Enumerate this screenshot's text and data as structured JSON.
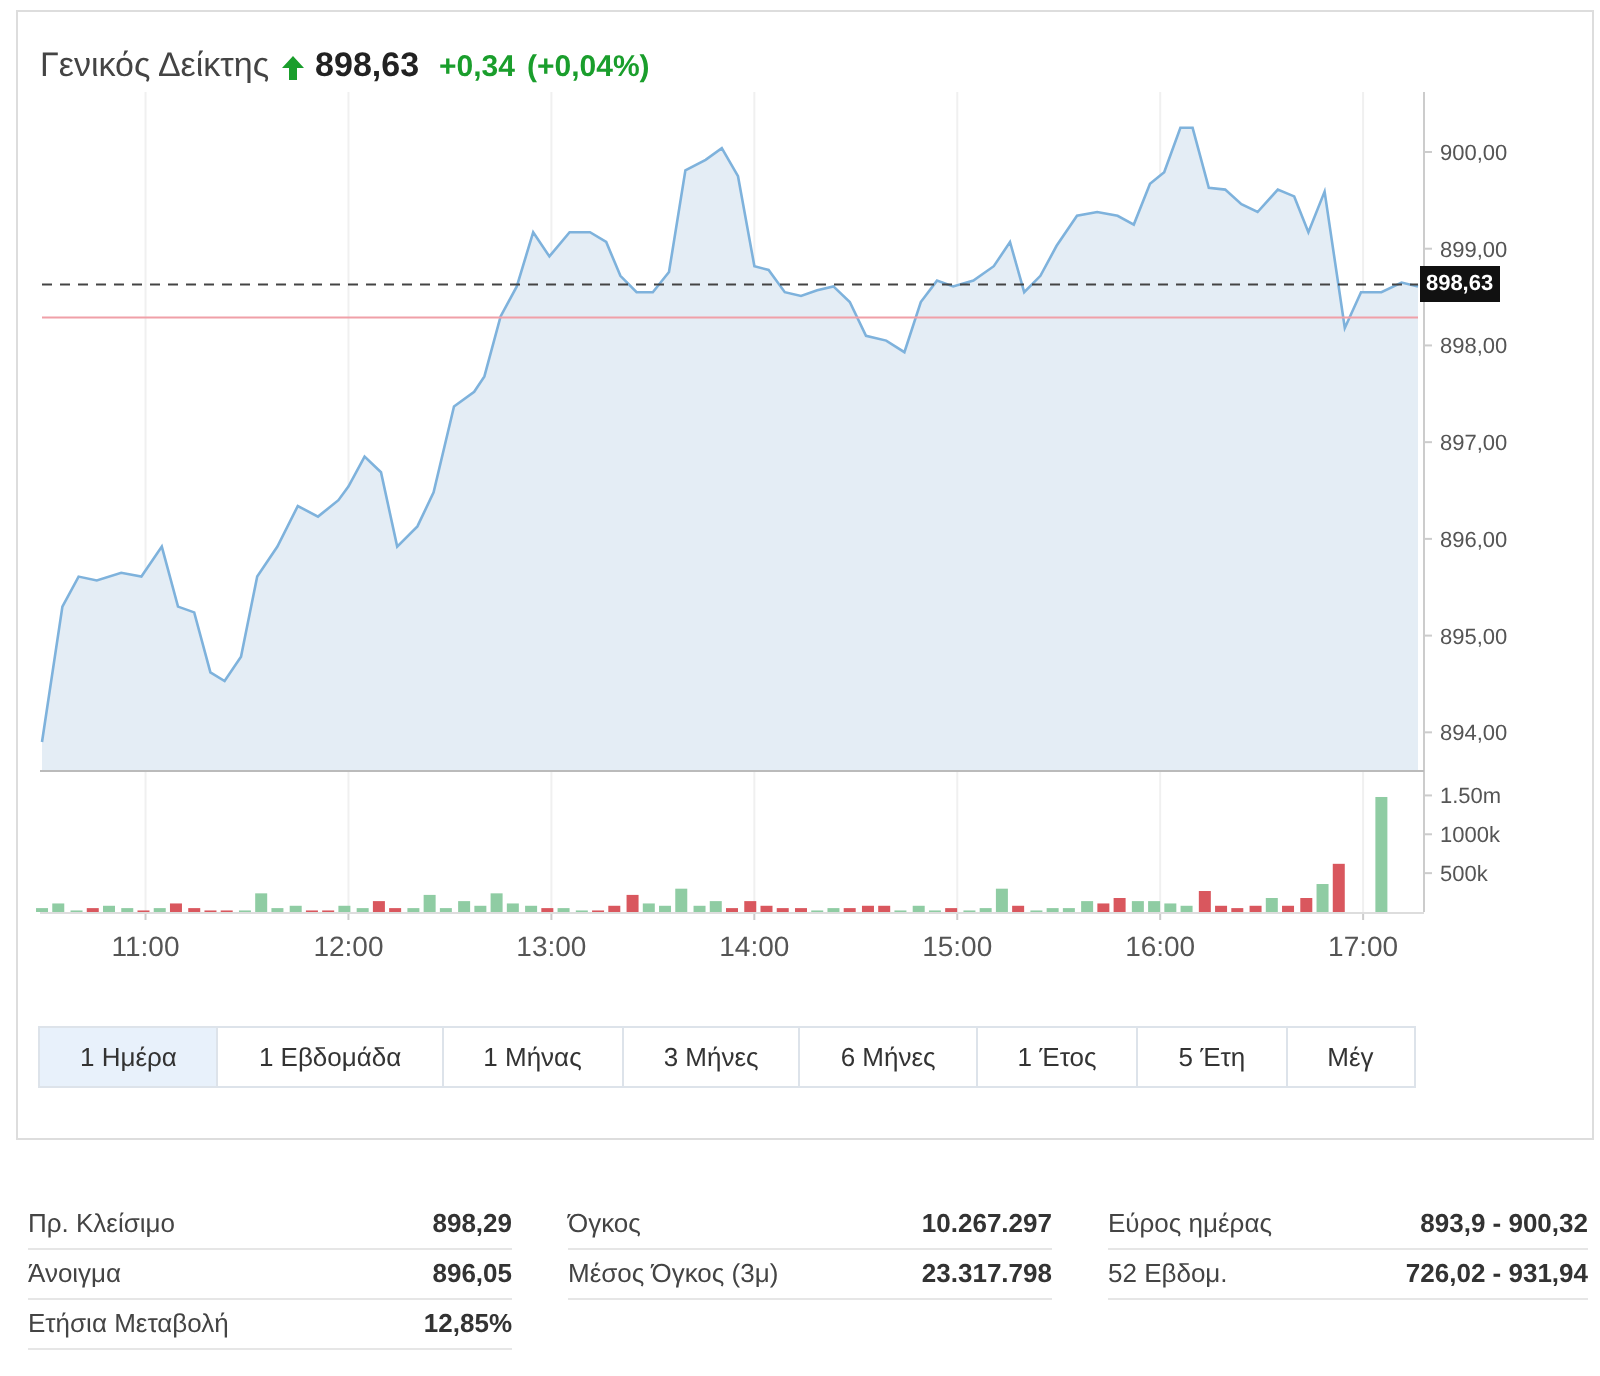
{
  "header": {
    "title": "Γενικός Δείκτης",
    "rising": true,
    "price": "898,63",
    "change": "+0,34",
    "change_percent": "(+0,04%)"
  },
  "price_chart": {
    "chart_data": {
      "type": "area",
      "grid": true,
      "xlim": [
        10.48,
        17.3
      ],
      "ylim": [
        893.59,
        900.62
      ],
      "yticks": [
        {
          "value": 894,
          "label": "894,00"
        },
        {
          "value": 895,
          "label": "895,00"
        },
        {
          "value": 896,
          "label": "896,00"
        },
        {
          "value": 897,
          "label": "897,00"
        },
        {
          "value": 898,
          "label": "898,00"
        },
        {
          "value": 899,
          "label": "899,00"
        },
        {
          "value": 900,
          "label": "900,00"
        }
      ],
      "x": [
        10.49,
        10.59,
        10.67,
        10.76,
        10.88,
        10.98,
        11.08,
        11.16,
        11.24,
        11.32,
        11.39,
        11.47,
        11.55,
        11.65,
        11.75,
        11.85,
        11.95,
        12.0,
        12.08,
        12.16,
        12.24,
        12.34,
        12.42,
        12.52,
        12.62,
        12.67,
        12.75,
        12.83,
        12.91,
        12.99,
        13.09,
        13.19,
        13.27,
        13.34,
        13.42,
        13.5,
        13.58,
        13.66,
        13.76,
        13.84,
        13.92,
        14.0,
        14.07,
        14.15,
        14.23,
        14.31,
        14.39,
        14.47,
        14.55,
        14.65,
        14.74,
        14.82,
        14.9,
        14.98,
        15.08,
        15.18,
        15.26,
        15.33,
        15.41,
        15.49,
        15.59,
        15.69,
        15.79,
        15.87,
        15.95,
        16.02,
        16.1,
        16.16,
        16.24,
        16.32,
        16.4,
        16.48,
        16.58,
        16.66,
        16.73,
        16.81,
        16.91,
        16.99,
        17.09,
        17.19,
        17.27
      ],
      "series": [
        {
          "color": "#7eb2dc",
          "values": [
            893.9,
            895.3,
            895.61,
            895.57,
            895.65,
            895.61,
            895.92,
            895.3,
            895.24,
            894.62,
            894.53,
            894.78,
            895.61,
            895.92,
            896.34,
            896.23,
            896.4,
            896.54,
            896.85,
            896.69,
            895.92,
            896.13,
            896.48,
            897.37,
            897.52,
            897.68,
            898.3,
            898.61,
            899.17,
            898.92,
            899.17,
            899.17,
            899.07,
            898.72,
            898.55,
            898.55,
            898.76,
            899.81,
            899.92,
            900.04,
            899.75,
            898.82,
            898.78,
            898.55,
            898.51,
            898.57,
            898.61,
            898.45,
            898.1,
            898.05,
            897.93,
            898.45,
            898.67,
            898.61,
            898.67,
            898.82,
            899.07,
            898.55,
            898.72,
            899.03,
            899.34,
            899.38,
            899.34,
            899.25,
            899.67,
            899.79,
            900.25,
            900.25,
            899.63,
            899.61,
            899.46,
            899.38,
            899.61,
            899.54,
            899.17,
            899.59,
            898.18,
            898.55,
            898.55,
            898.65,
            898.61
          ]
        },
        {
          "color": "#444444",
          "type": "line",
          "line_style": "dashed",
          "values": [
            898.63,
            null,
            null,
            null,
            null,
            null,
            null,
            null,
            null,
            null,
            null,
            null,
            null,
            null,
            null,
            null,
            null,
            null,
            null,
            null,
            null,
            null,
            null,
            null,
            null,
            null,
            null,
            null,
            null,
            null,
            null,
            null,
            null,
            null,
            null,
            null,
            null,
            null,
            null,
            null,
            null,
            null,
            null,
            null,
            null,
            null,
            null,
            null,
            null,
            null,
            null,
            null,
            null,
            null,
            null,
            null,
            null,
            null,
            null,
            null,
            null,
            null,
            null,
            null,
            null,
            null,
            null,
            null,
            null,
            null,
            null,
            null,
            null,
            null,
            null,
            null,
            null,
            null,
            null,
            null,
            898.63
          ]
        },
        {
          "color": "#f0a0a8",
          "type": "line",
          "values": [
            898.29,
            null,
            null,
            null,
            null,
            null,
            null,
            null,
            null,
            null,
            null,
            null,
            null,
            null,
            null,
            null,
            null,
            null,
            null,
            null,
            null,
            null,
            null,
            null,
            null,
            null,
            null,
            null,
            null,
            null,
            null,
            null,
            null,
            null,
            null,
            null,
            null,
            null,
            null,
            null,
            null,
            null,
            null,
            null,
            null,
            null,
            null,
            null,
            null,
            null,
            null,
            null,
            null,
            null,
            null,
            null,
            null,
            null,
            null,
            null,
            null,
            null,
            null,
            null,
            null,
            null,
            null,
            null,
            null,
            null,
            null,
            null,
            null,
            null,
            null,
            null,
            null,
            null,
            null,
            null,
            898.29
          ]
        }
      ],
      "annotations": [
        {
          "text": "898,63",
          "x": 17.27,
          "y": 898.63
        }
      ]
    }
  },
  "volume_chart": {
    "chart_data": {
      "type": "bar",
      "stacked": true,
      "grid": true,
      "xlim": [
        10.48,
        17.3
      ],
      "ylim": [
        0,
        1750000
      ],
      "xticks": [
        {
          "value": 11,
          "label": "11:00"
        },
        {
          "value": 12,
          "label": "12:00"
        },
        {
          "value": 13,
          "label": "13:00"
        },
        {
          "value": 14,
          "label": "14:00"
        },
        {
          "value": 15,
          "label": "15:00"
        },
        {
          "value": 16,
          "label": "16:00"
        },
        {
          "value": 17,
          "label": "17:00"
        }
      ],
      "yticks": [
        {
          "value": 500000,
          "label": "500k"
        },
        {
          "value": 1000000,
          "label": "1000k"
        },
        {
          "value": 1500000,
          "label": "1.50m"
        }
      ],
      "x": [
        10.49,
        10.57,
        10.66,
        10.74,
        10.82,
        10.91,
        10.99,
        11.07,
        11.15,
        11.24,
        11.32,
        11.4,
        11.49,
        11.57,
        11.65,
        11.74,
        11.82,
        11.9,
        11.98,
        12.07,
        12.15,
        12.23,
        12.32,
        12.4,
        12.48,
        12.57,
        12.65,
        12.73,
        12.81,
        12.9,
        12.98,
        13.06,
        13.15,
        13.23,
        13.31,
        13.4,
        13.48,
        13.56,
        13.64,
        13.73,
        13.81,
        13.89,
        13.98,
        14.06,
        14.14,
        14.23,
        14.31,
        14.39,
        14.47,
        14.56,
        14.64,
        14.72,
        14.81,
        14.89,
        14.97,
        15.06,
        15.14,
        15.22,
        15.3,
        15.39,
        15.47,
        15.55,
        15.64,
        15.72,
        15.8,
        15.89,
        15.97,
        16.05,
        16.13,
        16.22,
        16.3,
        16.38,
        16.47,
        16.55,
        16.63,
        16.72,
        16.8,
        16.88,
        17.09
      ],
      "series": [
        {
          "color": "#8fcca3",
          "values": [
            50000,
            110000,
            20000,
            null,
            80000,
            50000,
            null,
            50000,
            null,
            null,
            null,
            null,
            20000,
            240000,
            50000,
            80000,
            null,
            null,
            80000,
            50000,
            null,
            null,
            50000,
            220000,
            50000,
            140000,
            80000,
            240000,
            110000,
            80000,
            null,
            50000,
            20000,
            null,
            null,
            null,
            110000,
            80000,
            300000,
            80000,
            140000,
            null,
            null,
            null,
            null,
            null,
            20000,
            50000,
            null,
            null,
            null,
            20000,
            80000,
            20000,
            null,
            20000,
            50000,
            300000,
            null,
            20000,
            50000,
            50000,
            140000,
            null,
            null,
            140000,
            140000,
            110000,
            80000,
            null,
            null,
            null,
            null,
            180000,
            null,
            null,
            360000,
            null,
            1480000
          ]
        },
        {
          "color": "#d9575e",
          "values": [
            null,
            null,
            null,
            50000,
            null,
            null,
            20000,
            null,
            110000,
            50000,
            20000,
            20000,
            null,
            null,
            null,
            null,
            20000,
            20000,
            null,
            null,
            140000,
            50000,
            null,
            null,
            null,
            null,
            null,
            null,
            null,
            null,
            50000,
            null,
            null,
            20000,
            80000,
            220000,
            null,
            null,
            null,
            null,
            null,
            50000,
            140000,
            80000,
            50000,
            50000,
            null,
            null,
            50000,
            80000,
            80000,
            null,
            null,
            null,
            50000,
            null,
            null,
            null,
            80000,
            null,
            null,
            null,
            null,
            110000,
            180000,
            null,
            null,
            null,
            null,
            270000,
            80000,
            50000,
            80000,
            null,
            80000,
            180000,
            null,
            620000,
            null
          ]
        }
      ]
    }
  },
  "range_tabs": [
    {
      "label": "1 Ημέρα",
      "selected": true
    },
    {
      "label": "1 Εβδομάδα",
      "selected": false
    },
    {
      "label": "1 Μήνας",
      "selected": false
    },
    {
      "label": "3 Μήνες",
      "selected": false
    },
    {
      "label": "6 Μήνες",
      "selected": false
    },
    {
      "label": "1 Έτος",
      "selected": false
    },
    {
      "label": "5 Έτη",
      "selected": false
    },
    {
      "label": "Μέγ",
      "selected": false
    }
  ],
  "stats": [
    [
      {
        "label": "Πρ. Κλείσιμο",
        "value": "898,29"
      },
      {
        "label": "Άνοιγμα",
        "value": "896,05"
      },
      {
        "label": "Ετήσια Μεταβολή",
        "value": "12,85%"
      }
    ],
    [
      {
        "label": "Όγκος",
        "value": "10.267.297"
      },
      {
        "label": "Μέσος Όγκος (3μ)",
        "value": "23.317.798"
      }
    ],
    [
      {
        "label": "Εύρος ημέρας",
        "value": "893,9 - 900,32"
      },
      {
        "label": "52 Εβδομ.",
        "value": "726,02 - 931,94"
      }
    ]
  ]
}
